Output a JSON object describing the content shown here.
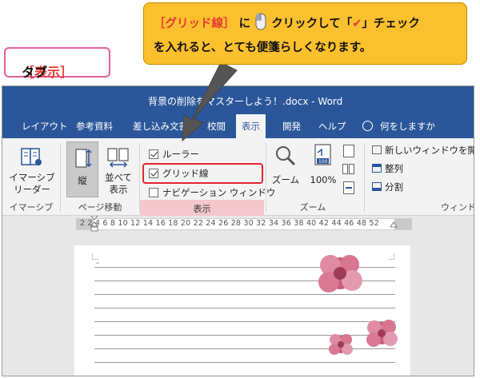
{
  "callout": {
    "line1_bracket_text": "［グリッド線］",
    "line1_part2": "に",
    "line1_part3": "クリックして「",
    "line1_check": "✔",
    "line1_part4": "」チェック",
    "line2": "を入れると、とても便箋らしくなります。",
    "mouse_icon": "mouse-icon"
  },
  "tab_label": {
    "bracket_text": "［表示］",
    "suffix": "タブ"
  },
  "window": {
    "title": "背景の削除をマスターしよう！.docx  -  Word"
  },
  "tabs": [
    {
      "label": "レイアウト"
    },
    {
      "label": "参考資料"
    },
    {
      "label": "差し込み文書"
    },
    {
      "label": "校閲"
    },
    {
      "label": "表示",
      "active": true
    },
    {
      "label": "開発"
    },
    {
      "label": "ヘルプ"
    },
    {
      "label": "何をしますか"
    }
  ],
  "ribbon": {
    "immersive": {
      "button_label": "イマーシブ\nリーダー",
      "group": "イマーシブ"
    },
    "page_move": {
      "vertical_label": "縦",
      "side_label": "並べて\n表示",
      "group": "ページ移動"
    },
    "show": {
      "ruler": {
        "label": "ルーラー",
        "checked": true
      },
      "gridlines": {
        "label": "グリッド線",
        "checked": true
      },
      "navigation": {
        "label": "ナビゲーション ウィンドウ",
        "checked": false
      },
      "group": "表示"
    },
    "zoom": {
      "zoom_label": "ズーム",
      "percent_label": "100%",
      "icon_number": "100",
      "group": "ズーム"
    },
    "window": {
      "new_window": "新しいウィンドウを開く",
      "arrange": "整列",
      "split": "分割",
      "group": "ウィンドウ"
    }
  },
  "ruler": {
    "text": "2    2   4   6   8  10  12  14  16  18  20  22  24  26  28  30  32  34  36  38  40  42  44  46  48       52"
  },
  "colors": {
    "word_blue": "#2b579a",
    "callout_yellow": "#fbc02d",
    "highlight_red": "#e0262f",
    "tab_pink": "#e0609f"
  }
}
